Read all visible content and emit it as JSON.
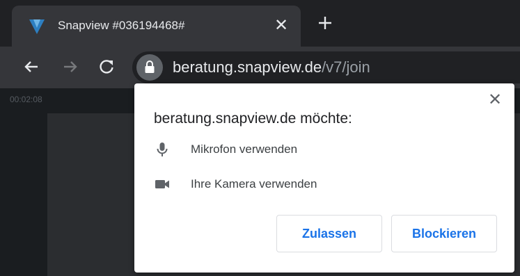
{
  "browser": {
    "tab": {
      "title": "Snapview #036194468#",
      "favicon": "snapview-v-logo",
      "close_glyph": "✕"
    },
    "new_tab_icon": "plus-icon",
    "toolbar": {
      "back_icon": "back-arrow-icon",
      "forward_icon": "forward-arrow-icon",
      "reload_icon": "reload-icon",
      "url_host": "beratung.snapview.de",
      "url_path": "/v7/join",
      "lock_icon": "lock-icon"
    }
  },
  "page": {
    "timer": "00:02:08"
  },
  "permission_popup": {
    "title": "beratung.snapview.de möchte:",
    "close_glyph": "✕",
    "permissions": [
      {
        "icon": "microphone-icon",
        "label": "Mikrofon verwenden"
      },
      {
        "icon": "camera-icon",
        "label": "Ihre Kamera verwenden"
      }
    ],
    "allow_label": "Zulassen",
    "block_label": "Blockieren"
  },
  "colors": {
    "tabstrip_bg": "#202124",
    "toolbar_bg": "#35363a",
    "button_text": "#1a73e8",
    "favicon_blue": "#2d7fc1"
  }
}
